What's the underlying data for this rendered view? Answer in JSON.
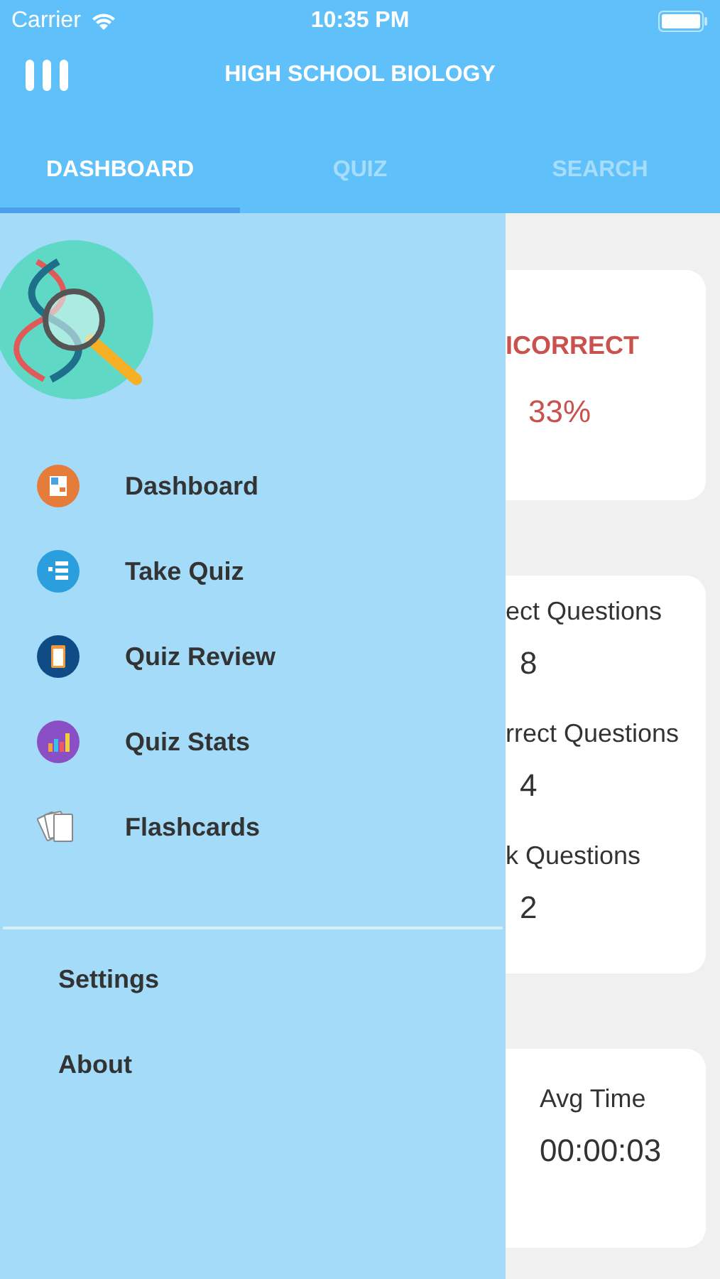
{
  "status_bar": {
    "carrier": "Carrier",
    "time": "10:35 PM"
  },
  "header": {
    "title": "HIGH SCHOOL BIOLOGY"
  },
  "tabs": [
    {
      "label": "DASHBOARD",
      "selected": true
    },
    {
      "label": "QUIZ",
      "selected": false
    },
    {
      "label": "SEARCH",
      "selected": false
    }
  ],
  "drawer": {
    "menu_items": [
      {
        "label": "Dashboard",
        "kind": "dashboard"
      },
      {
        "label": "Take Quiz",
        "kind": "quiz"
      },
      {
        "label": "Quiz Review",
        "kind": "review"
      },
      {
        "label": "Quiz Stats",
        "kind": "stats"
      },
      {
        "label": "Flashcards",
        "kind": "flashcards"
      }
    ],
    "secondary_items": [
      {
        "label": "Settings"
      },
      {
        "label": "About"
      }
    ]
  },
  "score_card": {
    "label": "ICORRECT",
    "value": "33%"
  },
  "questions_card": {
    "stats": [
      {
        "label": "ect Questions",
        "value": "8"
      },
      {
        "label": "rrect Questions",
        "value": "4"
      },
      {
        "label": "k Questions",
        "value": "2"
      }
    ]
  },
  "time_card": {
    "label": "Avg Time",
    "value": "00:00:03"
  }
}
